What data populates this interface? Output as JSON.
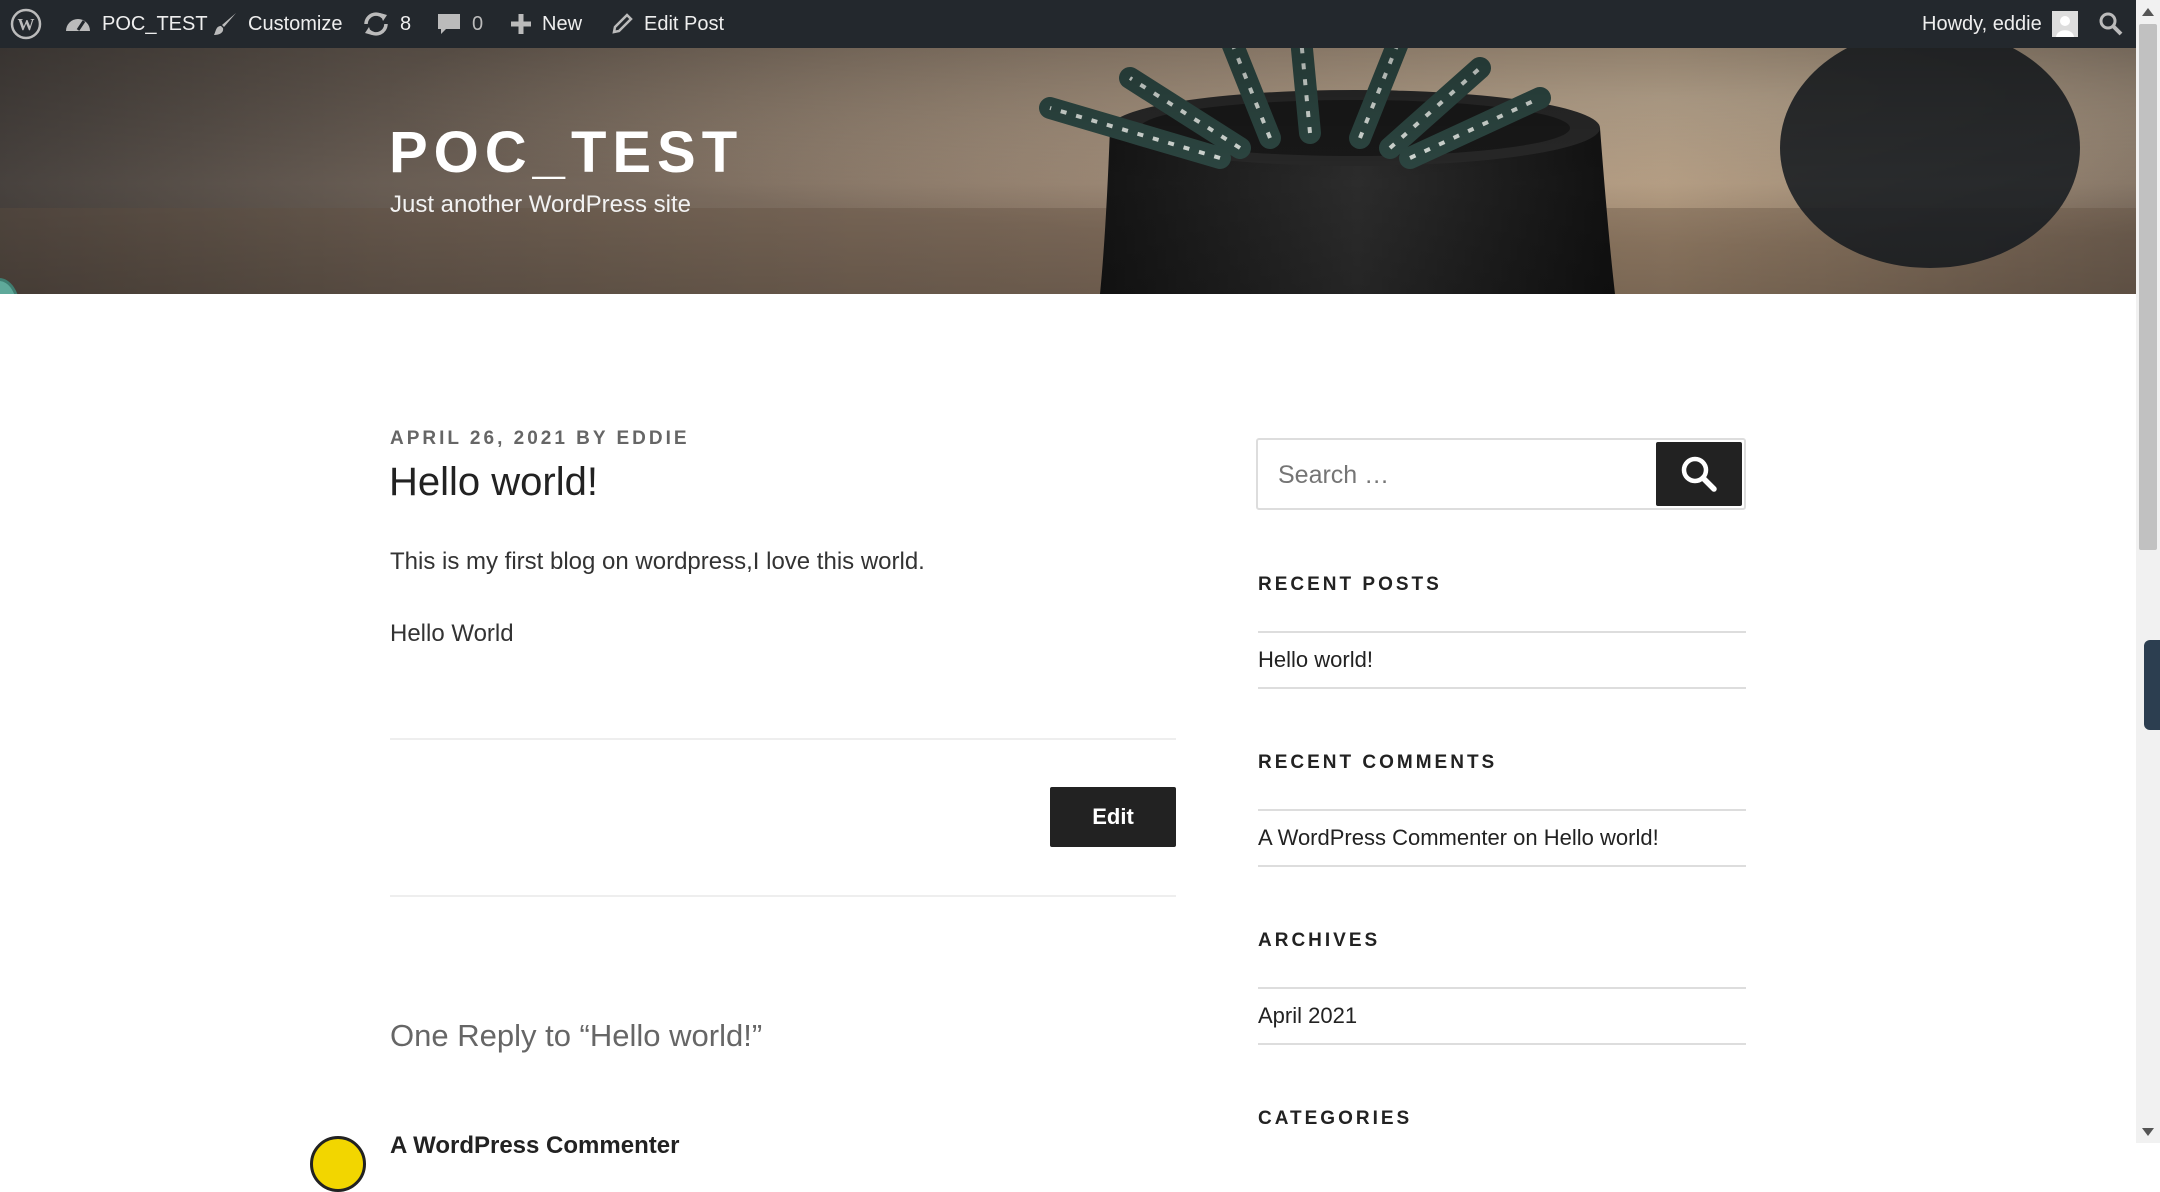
{
  "admin_bar": {
    "site_name": "POC_TEST",
    "customize": "Customize",
    "updates_count": "8",
    "comments_count": "0",
    "new_label": "New",
    "edit_post": "Edit Post",
    "greeting": "Howdy, eddie"
  },
  "header": {
    "site_title": "POC_TEST",
    "site_description": "Just another WordPress site"
  },
  "post": {
    "meta": "APRIL 26, 2021 BY EDDIE",
    "title": "Hello world!",
    "paragraphs": [
      "This is my first blog on wordpress,I love this world.",
      "Hello World"
    ],
    "edit_label": "Edit"
  },
  "comments": {
    "reply_title": "One Reply to “Hello world!”",
    "first_commenter": "A WordPress Commenter"
  },
  "sidebar": {
    "search_placeholder": "Search …",
    "recent_posts": {
      "title": "RECENT POSTS",
      "items": [
        "Hello world!"
      ]
    },
    "recent_comments": {
      "title": "RECENT COMMENTS",
      "author": "A WordPress Commenter",
      "on": "on",
      "post": "Hello world!"
    },
    "archives": {
      "title": "ARCHIVES",
      "items": [
        "April 2021"
      ]
    },
    "categories": {
      "title": "CATEGORIES"
    }
  }
}
